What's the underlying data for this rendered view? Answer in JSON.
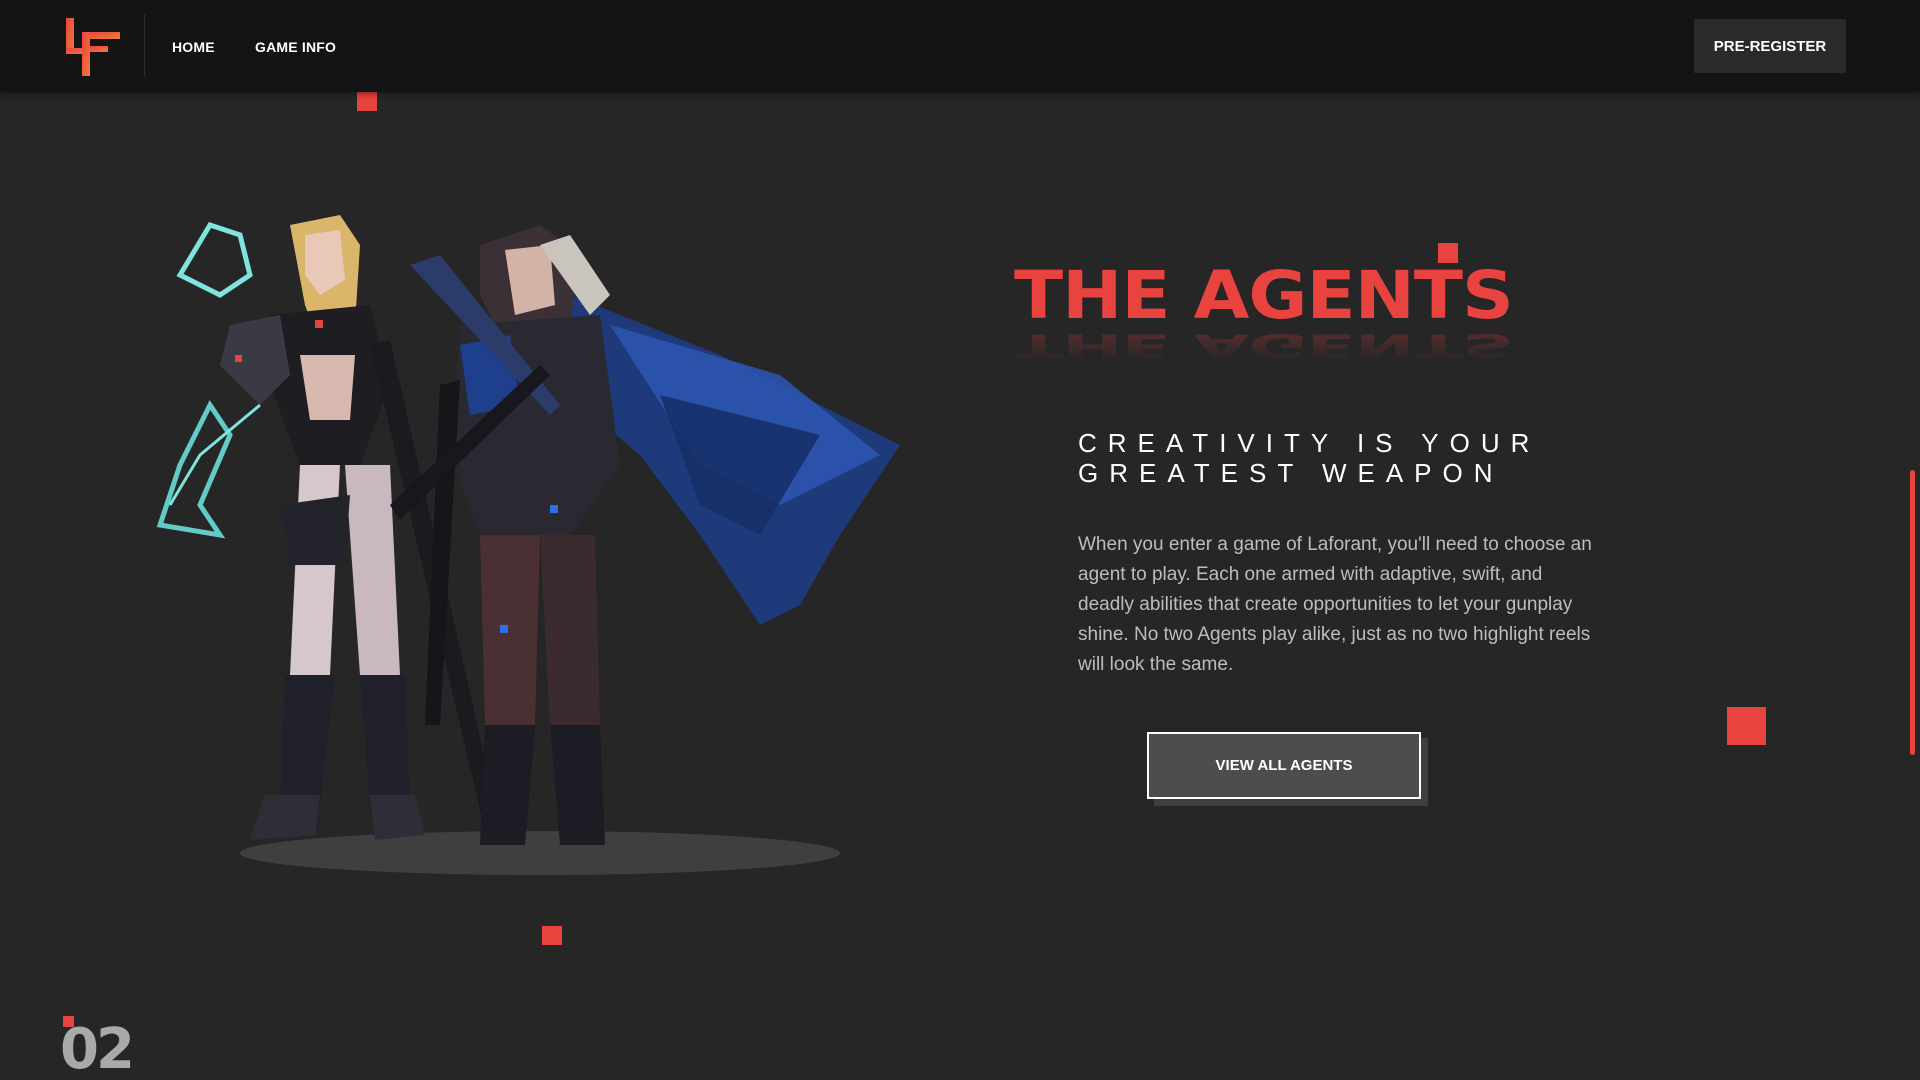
{
  "nav": {
    "home_label": "HOME",
    "gameinfo_label": "GAME INFO",
    "preregister_label": "PRE-REGISTER"
  },
  "hero": {
    "title": "THE AGENTS",
    "subtitle_line1": "CREATIVITY IS YOUR",
    "subtitle_line2": "GREATEST WEAPON",
    "body": "When you enter a game of Laforant, you'll need to choose an agent to play. Each one armed with adaptive, swift, and deadly abilities that create opportunities to let your gunplay shine. No two Agents play alike, just as no two highlight reels will look the same.",
    "cta_label": "VIEW ALL AGENTS",
    "section_number": "02"
  },
  "icons": {
    "logo": "lf-logo-icon"
  },
  "colors": {
    "accent": "#e8433f",
    "background": "#262627",
    "navbar": "#141414"
  }
}
